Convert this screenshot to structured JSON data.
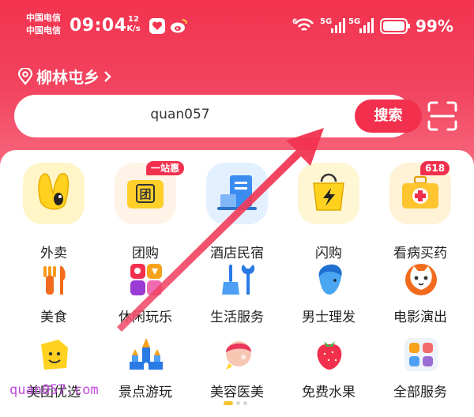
{
  "status_bar": {
    "carrier_1": "中国电信",
    "carrier_2": "中国电信",
    "time": "09:04",
    "net_speed_value": "12",
    "net_speed_unit": "K/s",
    "battery": "99%",
    "icons": [
      "heart-app-icon",
      "weibo-icon",
      "wifi-6-icon",
      "5g-signal-icon",
      "5g-signal-icon",
      "battery-icon"
    ]
  },
  "location": {
    "city": "柳林屯乡"
  },
  "search": {
    "query": "quan057",
    "button": "搜索"
  },
  "categories_big": [
    {
      "label": "外卖",
      "icon": "rabbit-ears-icon"
    },
    {
      "label": "团购",
      "icon": "ticket-icon",
      "badge": "一站惠"
    },
    {
      "label": "酒店民宿",
      "icon": "hotel-icon"
    },
    {
      "label": "闪购",
      "icon": "lightning-bag-icon"
    },
    {
      "label": "看病买药",
      "icon": "medical-kit-icon",
      "badge": "618"
    }
  ],
  "categories_small_row1": [
    {
      "label": "美食",
      "icon": "fork-knife-icon"
    },
    {
      "label": "休闲玩乐",
      "icon": "leisure-grid-icon"
    },
    {
      "label": "生活服务",
      "icon": "broom-wrench-icon"
    },
    {
      "label": "男士理发",
      "icon": "man-head-icon"
    },
    {
      "label": "电影演出",
      "icon": "cat-film-icon"
    }
  ],
  "categories_small_row2": [
    {
      "label": "美团优选",
      "icon": "smile-tag-icon"
    },
    {
      "label": "景点游玩",
      "icon": "castle-icon"
    },
    {
      "label": "美容医美",
      "icon": "beauty-face-icon"
    },
    {
      "label": "免费水果",
      "icon": "strawberry-icon"
    },
    {
      "label": "全部服务",
      "icon": "all-services-grid-icon"
    }
  ],
  "watermark": "quan057.com",
  "colors": {
    "brand_red": "#f2304d",
    "header_top": "#f2334f",
    "accent_yellow": "#f6c22c"
  }
}
